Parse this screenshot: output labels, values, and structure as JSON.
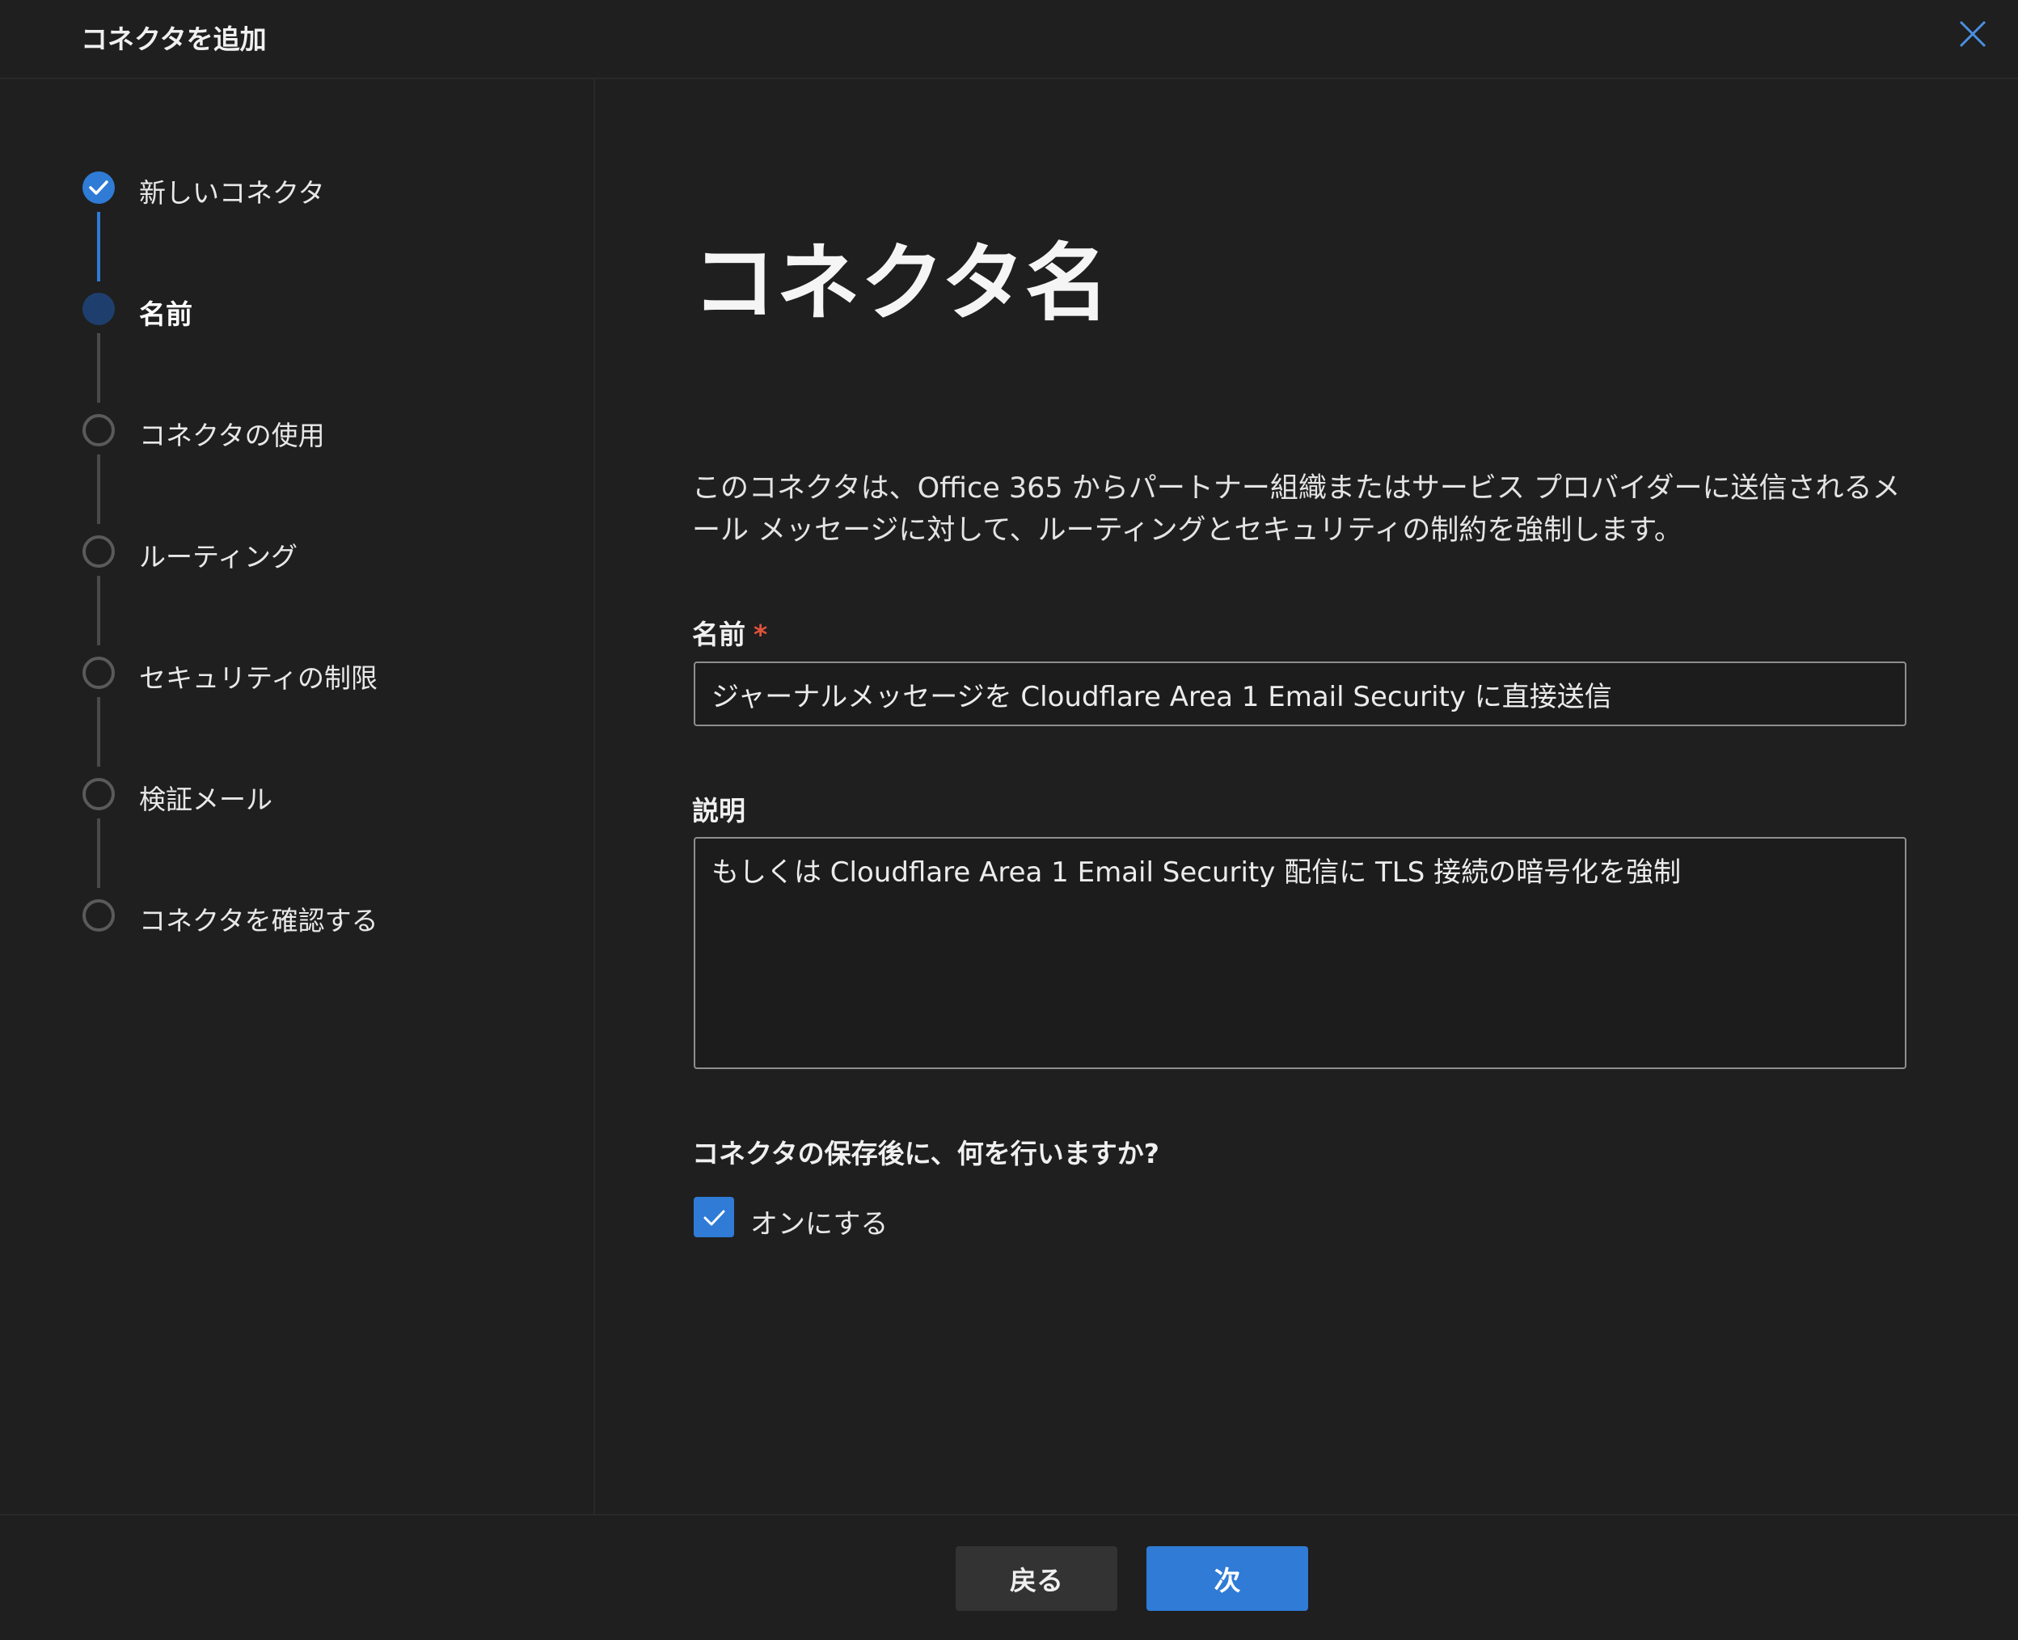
{
  "dialog": {
    "title": "コネクタを追加"
  },
  "steps": [
    {
      "label": "新しいコネクタ",
      "state": "completed"
    },
    {
      "label": "名前",
      "state": "current"
    },
    {
      "label": "コネクタの使用",
      "state": "pending"
    },
    {
      "label": "ルーティング",
      "state": "pending"
    },
    {
      "label": "セキュリティの制限",
      "state": "pending"
    },
    {
      "label": "検証メール",
      "state": "pending"
    },
    {
      "label": "コネクタを確認する",
      "state": "pending"
    }
  ],
  "main": {
    "title": "コネクタ名",
    "description": "このコネクタは、Office 365 からパートナー組織またはサービス プロバイダーに送信されるメール メッセージに対して、ルーティングとセキュリティの制約を強制します。",
    "name_field": {
      "label": "名前",
      "required_marker": "*",
      "value": "ジャーナルメッセージを Cloudflare Area 1 Email Security に直接送信"
    },
    "description_field": {
      "label": "説明",
      "value": "もしくは Cloudflare Area 1 Email Security 配信に TLS 接続の暗号化を強制"
    },
    "question": "コネクタの保存後に、何を行いますか?",
    "turn_on_checkbox": {
      "label": "オンにする",
      "checked": true
    }
  },
  "footer": {
    "back_label": "戻る",
    "next_label": "次"
  },
  "colors": {
    "background": "#1f1f1f",
    "accent": "#2f7bd6",
    "current_step": "#1e3f6e",
    "pending_step_border": "#5a5a5a",
    "required": "#e0533b"
  },
  "icons": {
    "close": "close-icon",
    "completed_step": "checkmark-circle-icon",
    "checkbox": "checkmark-icon"
  }
}
